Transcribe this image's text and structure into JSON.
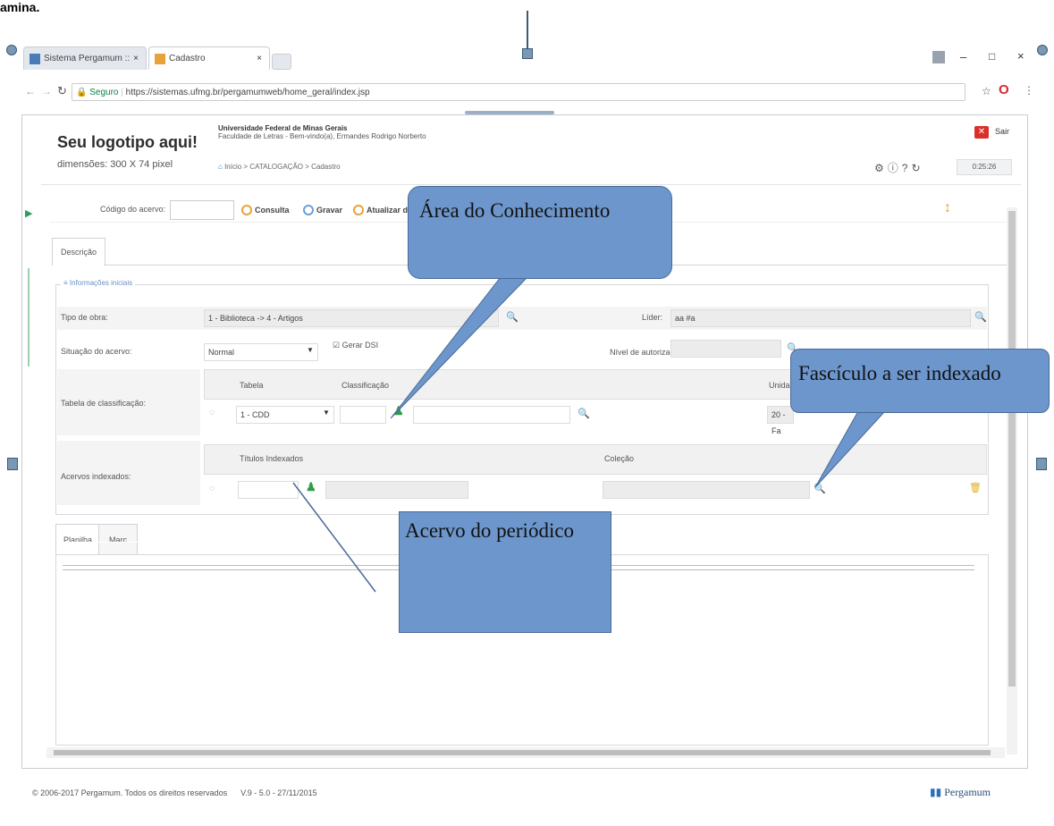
{
  "top_label": "amina.",
  "browser": {
    "tabs": [
      {
        "label": "Sistema Pergamum ::",
        "close": "×"
      },
      {
        "label": "Cadastro",
        "close": "×"
      }
    ],
    "url_secure": "Seguro",
    "url": "https://sistemas.ufmg.br/pergamumweb/home_geral/index.jsp",
    "window_controls": {
      "minimize": "–",
      "maximize": "□",
      "close": "×"
    }
  },
  "header": {
    "logo_title": "Seu logotipo aqui!",
    "logo_sub": "dimensões: 300 X 74 pixel",
    "org_name": "Universidade Federal de Minas Gerais",
    "org_unit": "Faculdade de Letras - Bem-vindo(a), Ermandes Rodrigo Norberto",
    "breadcrumb": "Início > CATALOGAÇÃO > Cadastro",
    "logout_label": "Sair",
    "clock": "0:25:26"
  },
  "toolbar": {
    "codigo_label": "Código do acervo:",
    "buttons": [
      "Consulta",
      "Gravar",
      "Atualizar d"
    ]
  },
  "tabs": {
    "descricao": "Descrição",
    "planilha": "Planilha",
    "marc": "Marc"
  },
  "fieldset_legend": "Informações iniciais",
  "form": {
    "tipo_obra_label": "Tipo de obra:",
    "tipo_obra_value": "1 - Biblioteca -> 4 - Artigos",
    "lider_label": "Líder:",
    "lider_value": "aa #a",
    "situacao_label": "Situação do acervo:",
    "situacao_value": "Normal",
    "gerar_dsi": "Gerar DSI",
    "nivel_label": "Nível de autorização:",
    "tabela_label": "Tabela de classificação:",
    "tabela_col": "Tabela",
    "classificacao_col": "Classificação",
    "unidade_col": "Unida",
    "tabela_value": "1 - CDD",
    "unidade_value": "20 - Fa",
    "acervos_label": "Acervos indexados:",
    "titulos_col": "Títulos Indexados",
    "colecao_col": "Coleção"
  },
  "callouts": {
    "area": "Área do Conhecimento",
    "fasciculo": "Fascículo a ser indexado",
    "acervo": "Acervo do periódico"
  },
  "footer": {
    "copyright": "© 2006-2017 Pergamum. Todos os direitos reservados",
    "version": "V.9 - 5.0 - 27/11/2015",
    "brand": "Pergamum"
  },
  "colors": {
    "callout": "#6d96cc",
    "callout_border": "#4a6a97",
    "logout": "#d9302b",
    "accent": "#e9a23b"
  }
}
